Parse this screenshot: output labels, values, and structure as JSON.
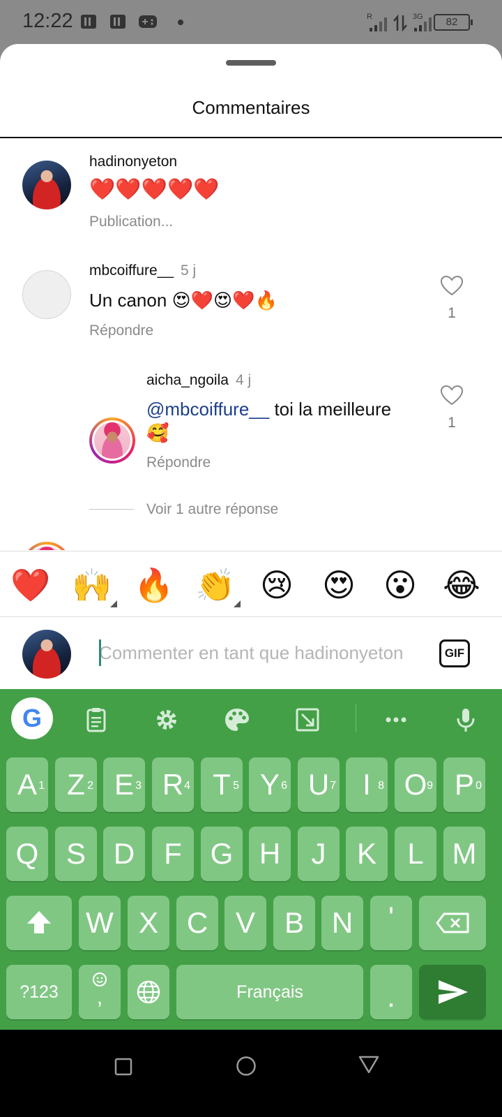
{
  "status_bar": {
    "time": "12:22",
    "network_r": "R",
    "network_3g": "3G",
    "battery": "82"
  },
  "sheet": {
    "title": "Commentaires"
  },
  "comments": [
    {
      "user": "hadinonyeton",
      "time": "",
      "text": "❤️❤️❤️❤️❤️",
      "action": "Publication..."
    },
    {
      "user": "mbcoiffure__",
      "time": "5 j",
      "text": "Un canon 😍❤️😍❤️🔥",
      "action": "Répondre",
      "likes": "1"
    },
    {
      "user": "aicha_ngoila",
      "time": "4 j",
      "mention": "@mbcoiffure__",
      "text": " toi la meilleure",
      "text_line2": "🥰",
      "action": "Répondre",
      "likes": "1"
    }
  ],
  "more_replies": "Voir 1 autre réponse",
  "emoji_bar": [
    "❤️",
    "🙌",
    "🔥",
    "👏",
    "😢",
    "😍",
    "😮",
    "😂"
  ],
  "input": {
    "placeholder": "Commenter en tant que hadinonyeton",
    "gif_label": "GIF"
  },
  "keyboard": {
    "row1": [
      {
        "k": "A",
        "h": "1"
      },
      {
        "k": "Z",
        "h": "2"
      },
      {
        "k": "E",
        "h": "3"
      },
      {
        "k": "R",
        "h": "4"
      },
      {
        "k": "T",
        "h": "5"
      },
      {
        "k": "Y",
        "h": "6"
      },
      {
        "k": "U",
        "h": "7"
      },
      {
        "k": "I",
        "h": "8"
      },
      {
        "k": "O",
        "h": "9"
      },
      {
        "k": "P",
        "h": "0"
      }
    ],
    "row2": [
      "Q",
      "S",
      "D",
      "F",
      "G",
      "H",
      "J",
      "K",
      "L",
      "M"
    ],
    "row3": [
      "W",
      "X",
      "C",
      "V",
      "B",
      "N",
      "'"
    ],
    "numbers_key": "?123",
    "comma_key": ",",
    "space_label": "Français",
    "period_key": ".",
    "accent_color": "#43a047"
  },
  "icons": [
    "google-icon",
    "clipboard-icon",
    "settings-icon",
    "palette-icon",
    "resize-icon",
    "more-icon",
    "mic-icon",
    "shift-icon",
    "backspace-icon",
    "emoji-icon",
    "globe-icon",
    "send-icon",
    "heart-icon",
    "square-icon",
    "circle-icon",
    "triangle-icon"
  ]
}
